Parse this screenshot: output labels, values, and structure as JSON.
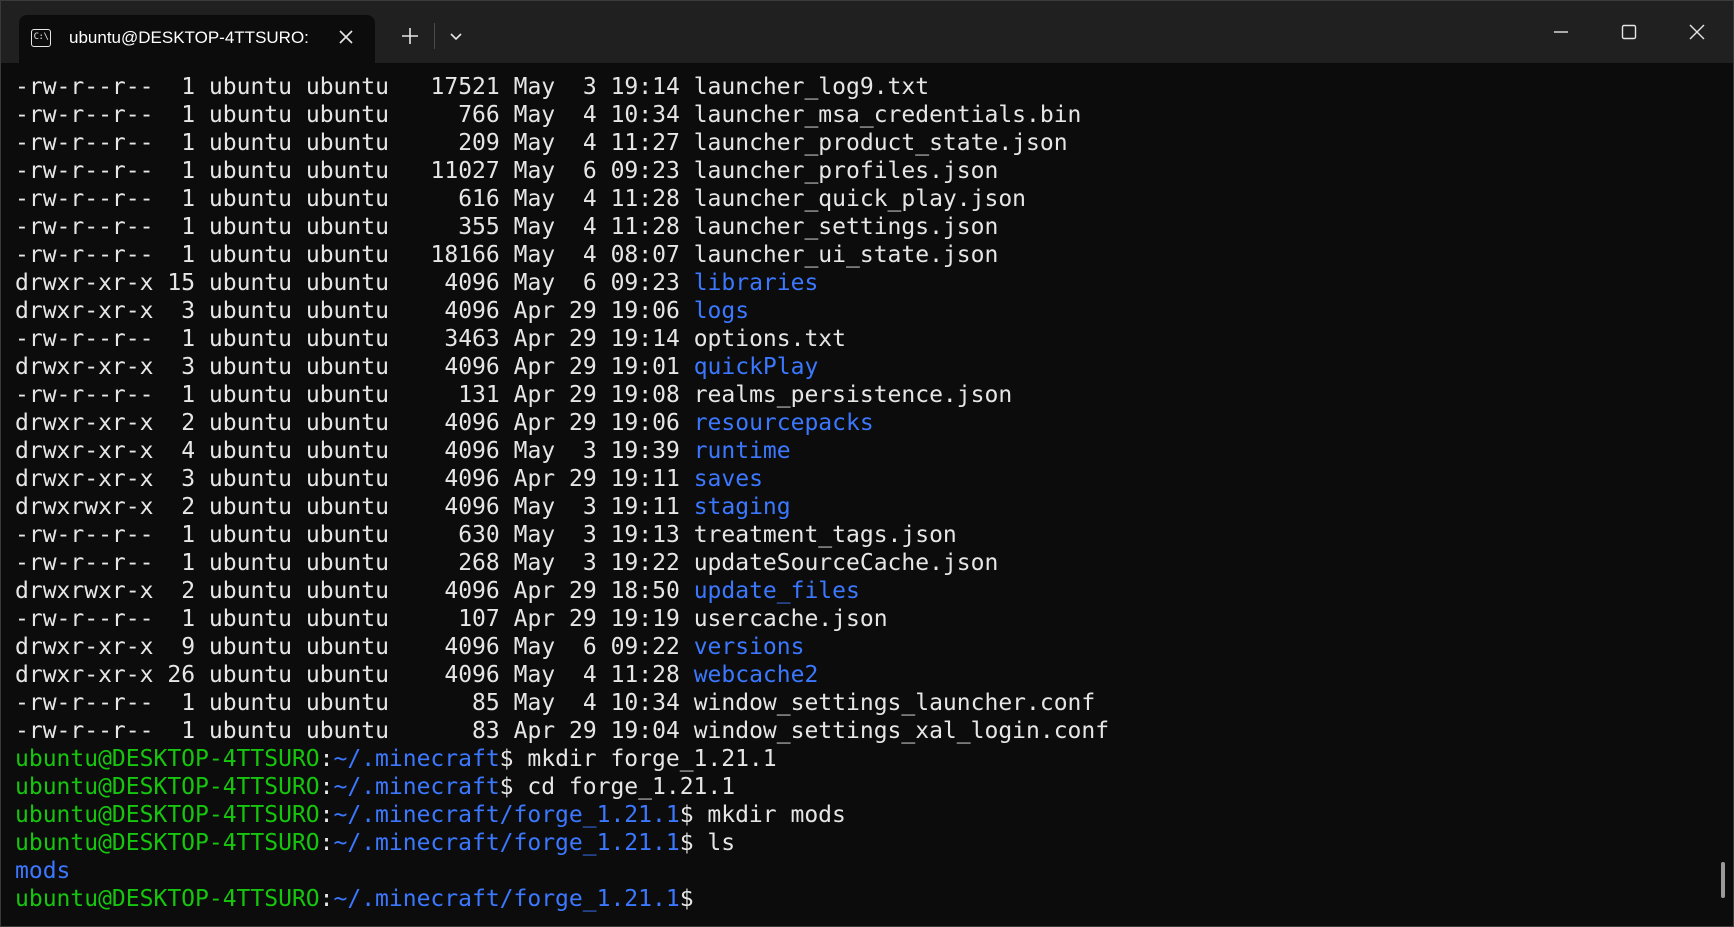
{
  "window": {
    "tab_title": "ubuntu@DESKTOP-4TTSURO:",
    "tab_icon_text": "C:\\"
  },
  "colors": {
    "background": "#0c0c0c",
    "titlebar": "#202020",
    "text": "#e6e6e6",
    "directory": "#3b78ff",
    "prompt_user": "#16c60c"
  },
  "icons": {
    "tab_icon": "terminal-icon",
    "close_tab": "close-icon",
    "new_tab": "plus-icon",
    "dropdown": "chevron-down-icon",
    "minimize": "minimize-icon",
    "maximize": "maximize-icon",
    "close_window": "close-icon"
  },
  "listing": [
    {
      "perms": "-rw-r--r--",
      "links": "1",
      "owner": "ubuntu",
      "group": "ubuntu",
      "size": "17521",
      "month": "May",
      "day": "3",
      "time": "19:14",
      "name": "launcher_log9.txt",
      "is_dir": false
    },
    {
      "perms": "-rw-r--r--",
      "links": "1",
      "owner": "ubuntu",
      "group": "ubuntu",
      "size": "766",
      "month": "May",
      "day": "4",
      "time": "10:34",
      "name": "launcher_msa_credentials.bin",
      "is_dir": false
    },
    {
      "perms": "-rw-r--r--",
      "links": "1",
      "owner": "ubuntu",
      "group": "ubuntu",
      "size": "209",
      "month": "May",
      "day": "4",
      "time": "11:27",
      "name": "launcher_product_state.json",
      "is_dir": false
    },
    {
      "perms": "-rw-r--r--",
      "links": "1",
      "owner": "ubuntu",
      "group": "ubuntu",
      "size": "11027",
      "month": "May",
      "day": "6",
      "time": "09:23",
      "name": "launcher_profiles.json",
      "is_dir": false
    },
    {
      "perms": "-rw-r--r--",
      "links": "1",
      "owner": "ubuntu",
      "group": "ubuntu",
      "size": "616",
      "month": "May",
      "day": "4",
      "time": "11:28",
      "name": "launcher_quick_play.json",
      "is_dir": false
    },
    {
      "perms": "-rw-r--r--",
      "links": "1",
      "owner": "ubuntu",
      "group": "ubuntu",
      "size": "355",
      "month": "May",
      "day": "4",
      "time": "11:28",
      "name": "launcher_settings.json",
      "is_dir": false
    },
    {
      "perms": "-rw-r--r--",
      "links": "1",
      "owner": "ubuntu",
      "group": "ubuntu",
      "size": "18166",
      "month": "May",
      "day": "4",
      "time": "08:07",
      "name": "launcher_ui_state.json",
      "is_dir": false
    },
    {
      "perms": "drwxr-xr-x",
      "links": "15",
      "owner": "ubuntu",
      "group": "ubuntu",
      "size": "4096",
      "month": "May",
      "day": "6",
      "time": "09:23",
      "name": "libraries",
      "is_dir": true
    },
    {
      "perms": "drwxr-xr-x",
      "links": "3",
      "owner": "ubuntu",
      "group": "ubuntu",
      "size": "4096",
      "month": "Apr",
      "day": "29",
      "time": "19:06",
      "name": "logs",
      "is_dir": true
    },
    {
      "perms": "-rw-r--r--",
      "links": "1",
      "owner": "ubuntu",
      "group": "ubuntu",
      "size": "3463",
      "month": "Apr",
      "day": "29",
      "time": "19:14",
      "name": "options.txt",
      "is_dir": false
    },
    {
      "perms": "drwxr-xr-x",
      "links": "3",
      "owner": "ubuntu",
      "group": "ubuntu",
      "size": "4096",
      "month": "Apr",
      "day": "29",
      "time": "19:01",
      "name": "quickPlay",
      "is_dir": true
    },
    {
      "perms": "-rw-r--r--",
      "links": "1",
      "owner": "ubuntu",
      "group": "ubuntu",
      "size": "131",
      "month": "Apr",
      "day": "29",
      "time": "19:08",
      "name": "realms_persistence.json",
      "is_dir": false
    },
    {
      "perms": "drwxr-xr-x",
      "links": "2",
      "owner": "ubuntu",
      "group": "ubuntu",
      "size": "4096",
      "month": "Apr",
      "day": "29",
      "time": "19:06",
      "name": "resourcepacks",
      "is_dir": true
    },
    {
      "perms": "drwxr-xr-x",
      "links": "4",
      "owner": "ubuntu",
      "group": "ubuntu",
      "size": "4096",
      "month": "May",
      "day": "3",
      "time": "19:39",
      "name": "runtime",
      "is_dir": true
    },
    {
      "perms": "drwxr-xr-x",
      "links": "3",
      "owner": "ubuntu",
      "group": "ubuntu",
      "size": "4096",
      "month": "Apr",
      "day": "29",
      "time": "19:11",
      "name": "saves",
      "is_dir": true
    },
    {
      "perms": "drwxrwxr-x",
      "links": "2",
      "owner": "ubuntu",
      "group": "ubuntu",
      "size": "4096",
      "month": "May",
      "day": "3",
      "time": "19:11",
      "name": "staging",
      "is_dir": true
    },
    {
      "perms": "-rw-r--r--",
      "links": "1",
      "owner": "ubuntu",
      "group": "ubuntu",
      "size": "630",
      "month": "May",
      "day": "3",
      "time": "19:13",
      "name": "treatment_tags.json",
      "is_dir": false
    },
    {
      "perms": "-rw-r--r--",
      "links": "1",
      "owner": "ubuntu",
      "group": "ubuntu",
      "size": "268",
      "month": "May",
      "day": "3",
      "time": "19:22",
      "name": "updateSourceCache.json",
      "is_dir": false
    },
    {
      "perms": "drwxrwxr-x",
      "links": "2",
      "owner": "ubuntu",
      "group": "ubuntu",
      "size": "4096",
      "month": "Apr",
      "day": "29",
      "time": "18:50",
      "name": "update_files",
      "is_dir": true
    },
    {
      "perms": "-rw-r--r--",
      "links": "1",
      "owner": "ubuntu",
      "group": "ubuntu",
      "size": "107",
      "month": "Apr",
      "day": "29",
      "time": "19:19",
      "name": "usercache.json",
      "is_dir": false
    },
    {
      "perms": "drwxr-xr-x",
      "links": "9",
      "owner": "ubuntu",
      "group": "ubuntu",
      "size": "4096",
      "month": "May",
      "day": "6",
      "time": "09:22",
      "name": "versions",
      "is_dir": true
    },
    {
      "perms": "drwxr-xr-x",
      "links": "26",
      "owner": "ubuntu",
      "group": "ubuntu",
      "size": "4096",
      "month": "May",
      "day": "4",
      "time": "11:28",
      "name": "webcache2",
      "is_dir": true
    },
    {
      "perms": "-rw-r--r--",
      "links": "1",
      "owner": "ubuntu",
      "group": "ubuntu",
      "size": "85",
      "month": "May",
      "day": "4",
      "time": "10:34",
      "name": "window_settings_launcher.conf",
      "is_dir": false
    },
    {
      "perms": "-rw-r--r--",
      "links": "1",
      "owner": "ubuntu",
      "group": "ubuntu",
      "size": "83",
      "month": "Apr",
      "day": "29",
      "time": "19:04",
      "name": "window_settings_xal_login.conf",
      "is_dir": false
    }
  ],
  "session": [
    {
      "type": "prompt",
      "user": "ubuntu@DESKTOP-4TTSURO",
      "path": "~/.minecraft",
      "command": "mkdir forge_1.21.1"
    },
    {
      "type": "prompt",
      "user": "ubuntu@DESKTOP-4TTSURO",
      "path": "~/.minecraft",
      "command": "cd forge_1.21.1"
    },
    {
      "type": "prompt",
      "user": "ubuntu@DESKTOP-4TTSURO",
      "path": "~/.minecraft/forge_1.21.1",
      "command": "mkdir mods"
    },
    {
      "type": "prompt",
      "user": "ubuntu@DESKTOP-4TTSURO",
      "path": "~/.minecraft/forge_1.21.1",
      "command": "ls"
    },
    {
      "type": "output_dir",
      "text": "mods"
    },
    {
      "type": "prompt",
      "user": "ubuntu@DESKTOP-4TTSURO",
      "path": "~/.minecraft/forge_1.21.1",
      "command": ""
    }
  ]
}
